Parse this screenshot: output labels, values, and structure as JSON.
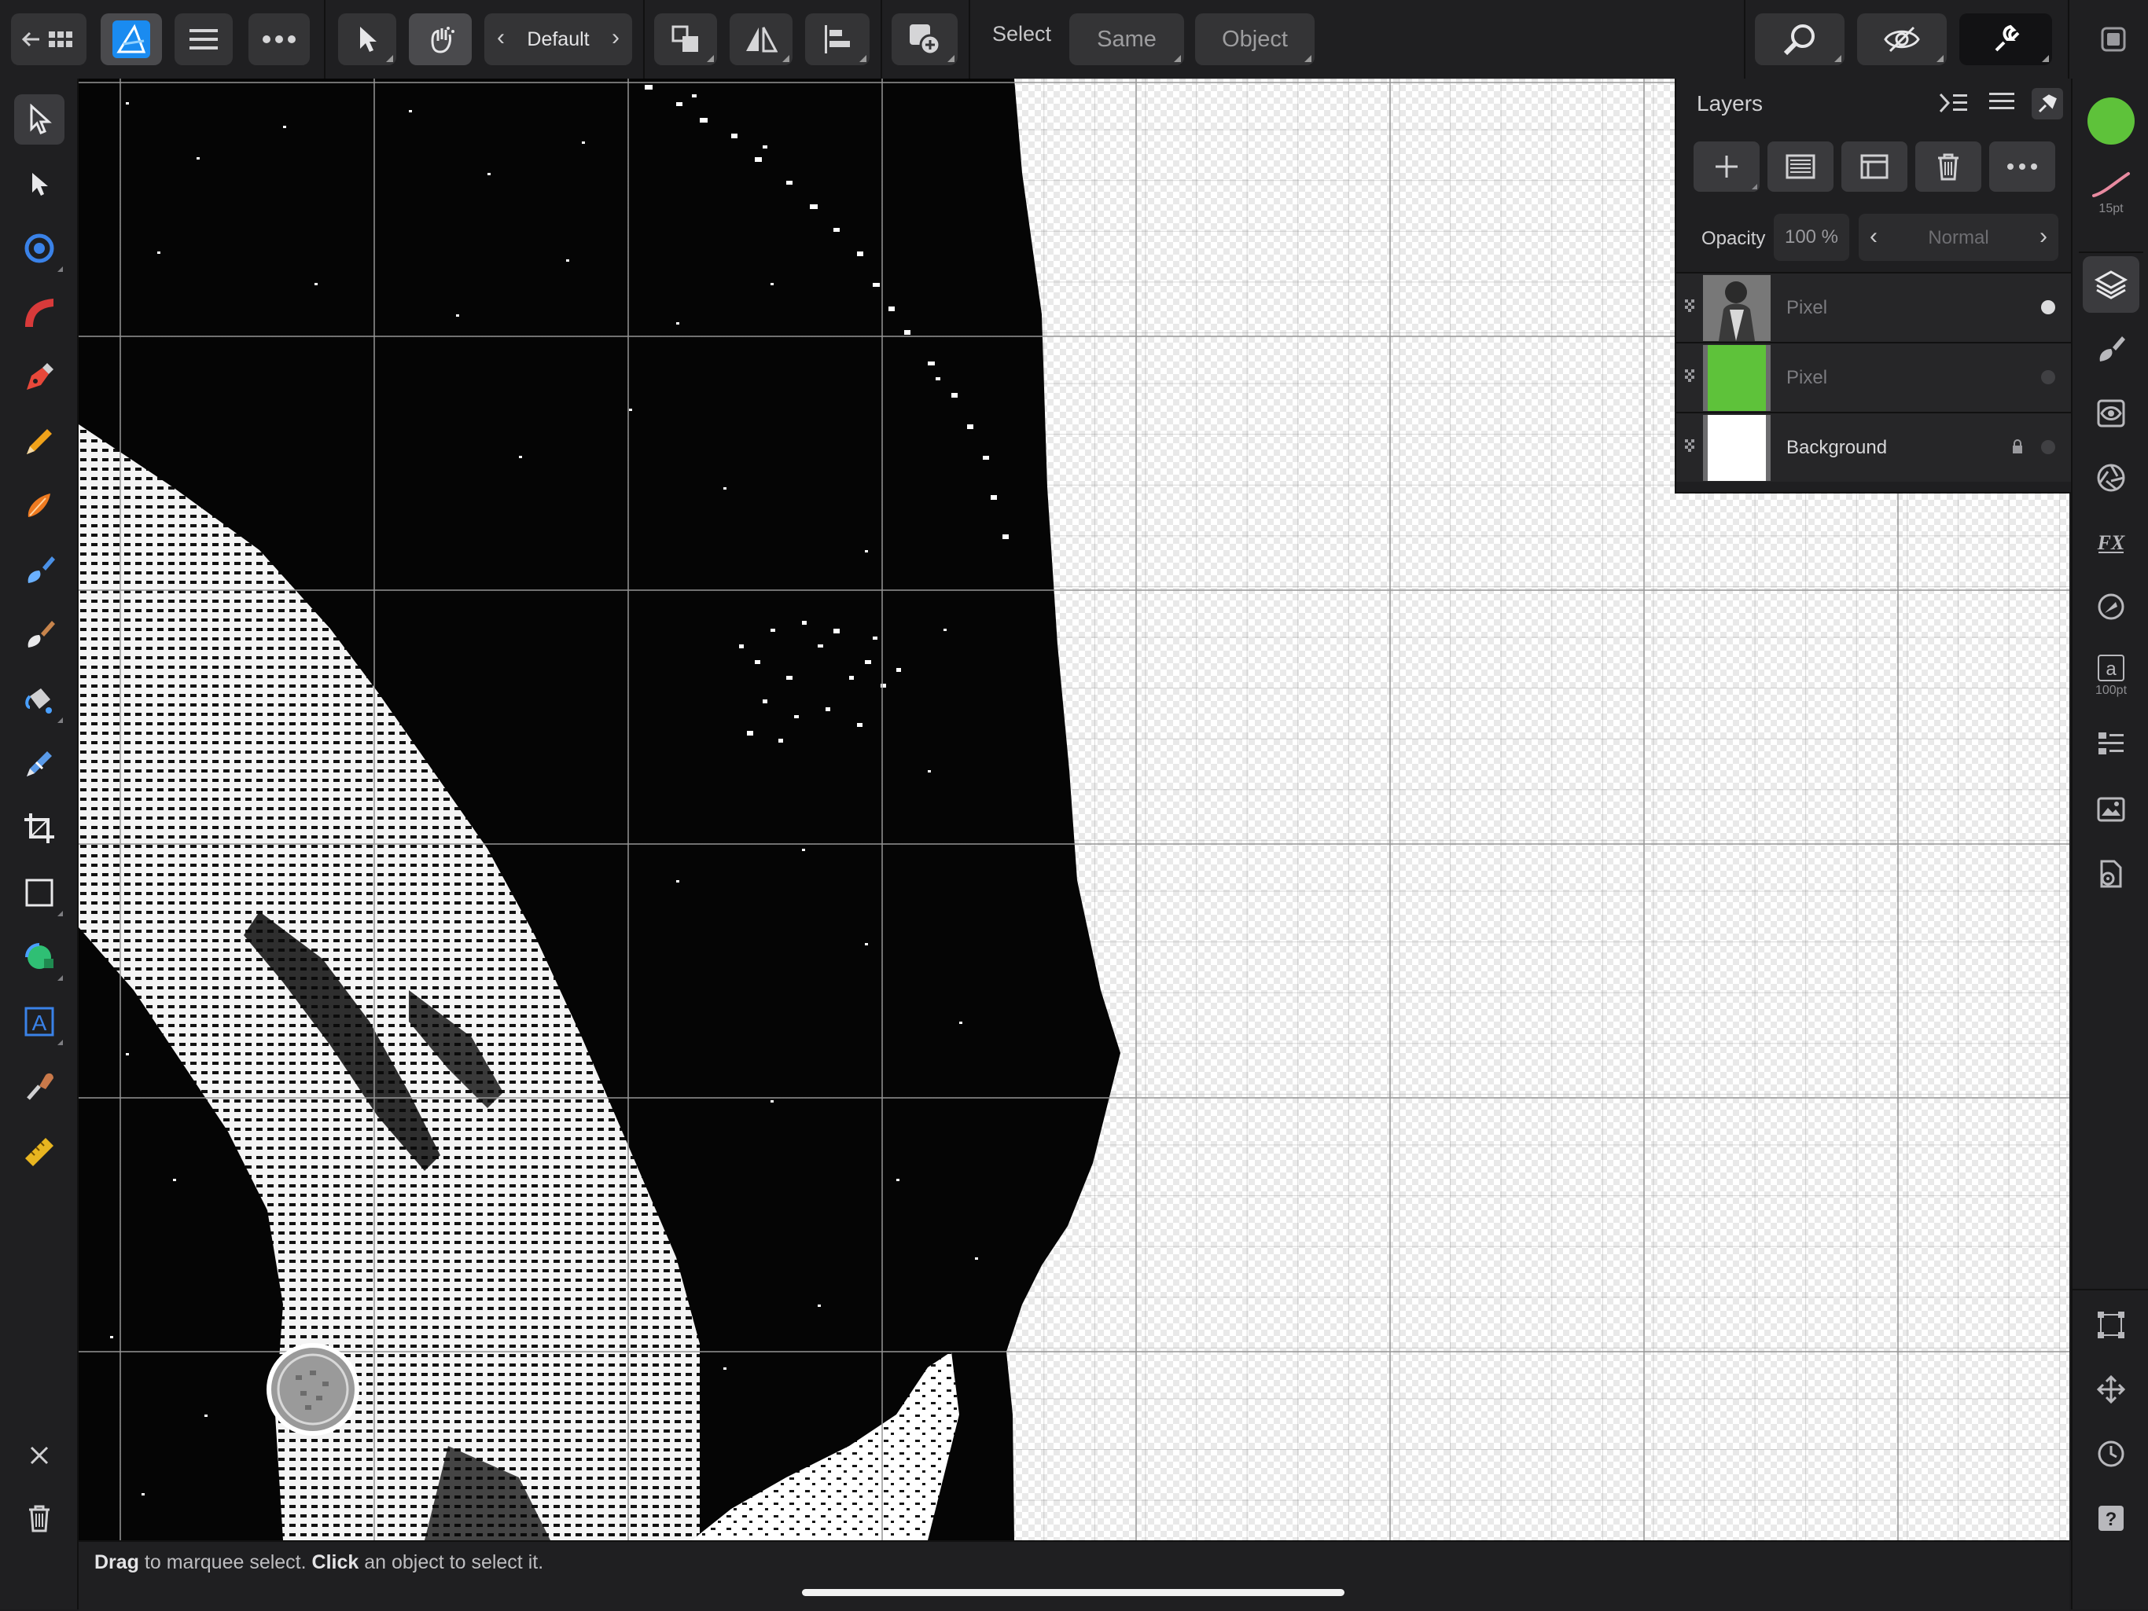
{
  "toolbar": {
    "preset": {
      "label": "Default",
      "prev_icon": "chevron-left-icon",
      "next_icon": "chevron-right-icon"
    },
    "select_label": "Select",
    "same_label": "Same",
    "object_label": "Object",
    "icons": [
      "back-to-gallery-icon",
      "affinity-designer-logo",
      "hamburger-menu-icon",
      "more-icon",
      "move-tool-icon",
      "snapping-icon",
      "arrange-icon",
      "flip-icon",
      "align-icon",
      "add-shape-icon",
      "view-zoom-icon",
      "view-mode-icon",
      "snapping-magnet-icon",
      "export-persona-icon"
    ]
  },
  "tools": [
    "move-tool",
    "node-tool",
    "corner-tool",
    "pencil-style-tool",
    "pen-tool",
    "pencil-tool",
    "vector-brush-tool",
    "paint-brush-tool",
    "pixel-brush-tool",
    "fill-tool",
    "color-picker-tool",
    "crop-tool",
    "rectangle-tool",
    "shape-tool",
    "text-tool",
    "eyedropper-tool",
    "measure-tool"
  ],
  "studio": {
    "stroke_size": "15pt",
    "text_size": "100pt",
    "fill_color": "#5ec23a",
    "stroke_color": "#e88aa0"
  },
  "layers": {
    "title": "Layers",
    "opacity_label": "Opacity",
    "opacity_value": "100 %",
    "blend_mode": "Normal",
    "items": [
      {
        "name": "Pixel",
        "thumb": "photo",
        "visible": true,
        "locked": false
      },
      {
        "name": "Pixel",
        "thumb": "green",
        "visible": false,
        "locked": false
      },
      {
        "name": "Background",
        "thumb": "white",
        "visible": false,
        "locked": true
      }
    ]
  },
  "status": {
    "drag": "Drag",
    "drag_rest": " to marquee select. ",
    "click": "Click",
    "click_rest": " an object to select it."
  },
  "colors": {
    "accent_blue": "#1a8bf0",
    "canvas_black": "#050505",
    "fill_green": "#5ec23a"
  }
}
